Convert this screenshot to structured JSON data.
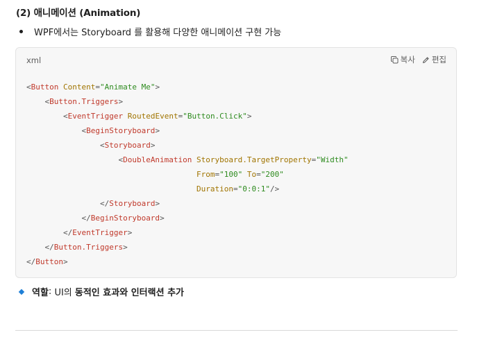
{
  "section_heading": "(2) 애니메이션 (Animation)",
  "intro_bullet": "WPF에서는 Storyboard 를 활용해 다양한 애니메이션 구현 가능",
  "code_block": {
    "language": "xml",
    "copy_label": "복사",
    "edit_label": "편집",
    "lines": [
      [
        [
          "p",
          "<"
        ],
        [
          "t",
          "Button"
        ],
        [
          "a",
          " Content"
        ],
        [
          "p",
          "="
        ],
        [
          "v",
          "\"Animate Me\""
        ],
        [
          "p",
          ">"
        ]
      ],
      [
        [
          "p",
          "    <"
        ],
        [
          "t",
          "Button.Triggers"
        ],
        [
          "p",
          ">"
        ]
      ],
      [
        [
          "p",
          "        <"
        ],
        [
          "t",
          "EventTrigger"
        ],
        [
          "a",
          " RoutedEvent"
        ],
        [
          "p",
          "="
        ],
        [
          "v",
          "\"Button.Click\""
        ],
        [
          "p",
          ">"
        ]
      ],
      [
        [
          "p",
          "            <"
        ],
        [
          "t",
          "BeginStoryboard"
        ],
        [
          "p",
          ">"
        ]
      ],
      [
        [
          "p",
          "                <"
        ],
        [
          "t",
          "Storyboard"
        ],
        [
          "p",
          ">"
        ]
      ],
      [
        [
          "p",
          "                    <"
        ],
        [
          "t",
          "DoubleAnimation"
        ],
        [
          "a",
          " Storyboard.TargetProperty"
        ],
        [
          "p",
          "="
        ],
        [
          "v",
          "\"Width\""
        ]
      ],
      [
        [
          "a",
          "                                     From"
        ],
        [
          "p",
          "="
        ],
        [
          "v",
          "\"100\""
        ],
        [
          "a",
          " To"
        ],
        [
          "p",
          "="
        ],
        [
          "v",
          "\"200\""
        ]
      ],
      [
        [
          "a",
          "                                     Duration"
        ],
        [
          "p",
          "="
        ],
        [
          "v",
          "\"0:0:1\""
        ],
        [
          "p",
          "/>"
        ]
      ],
      [
        [
          "p",
          "                </"
        ],
        [
          "t",
          "Storyboard"
        ],
        [
          "p",
          ">"
        ]
      ],
      [
        [
          "p",
          "            </"
        ],
        [
          "t",
          "BeginStoryboard"
        ],
        [
          "p",
          ">"
        ]
      ],
      [
        [
          "p",
          "        </"
        ],
        [
          "t",
          "EventTrigger"
        ],
        [
          "p",
          ">"
        ]
      ],
      [
        [
          "p",
          "    </"
        ],
        [
          "t",
          "Button.Triggers"
        ],
        [
          "p",
          ">"
        ]
      ],
      [
        [
          "p",
          "</"
        ],
        [
          "t",
          "Button"
        ],
        [
          "p",
          ">"
        ]
      ]
    ]
  },
  "role_item": {
    "label": "역할",
    "separator": ": ",
    "prefix": "UI의 ",
    "emphasis": "동적인 효과와 인터랙션 추가"
  }
}
